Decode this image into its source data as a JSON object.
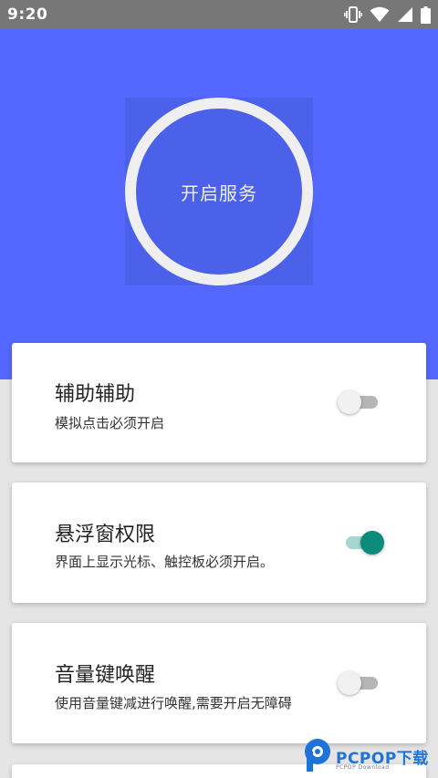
{
  "status_bar": {
    "time": "9:20",
    "icons": [
      "vibrate-icon",
      "wifi-icon",
      "signal-icon",
      "battery-icon"
    ]
  },
  "hero": {
    "service_button_label": "开启服务",
    "background_color": "#5468ff",
    "ring_color": "#efefef"
  },
  "settings": [
    {
      "title": "辅助辅助",
      "subtitle": "模拟点击必须开启",
      "enabled": false
    },
    {
      "title": "悬浮窗权限",
      "subtitle": "界面上显示光标、触控板必须开启。",
      "enabled": true
    },
    {
      "title": "音量键唤醒",
      "subtitle": "使用音量键减进行唤醒,需要开启无障碍",
      "enabled": false
    }
  ],
  "colors": {
    "toggle_on": "#0c8a7a",
    "toggle_on_track": "#a6d6d1",
    "toggle_off_track": "#b5b5b5"
  },
  "watermark": {
    "text": "PCPOP下载",
    "subtext": "PCPOP Download"
  }
}
